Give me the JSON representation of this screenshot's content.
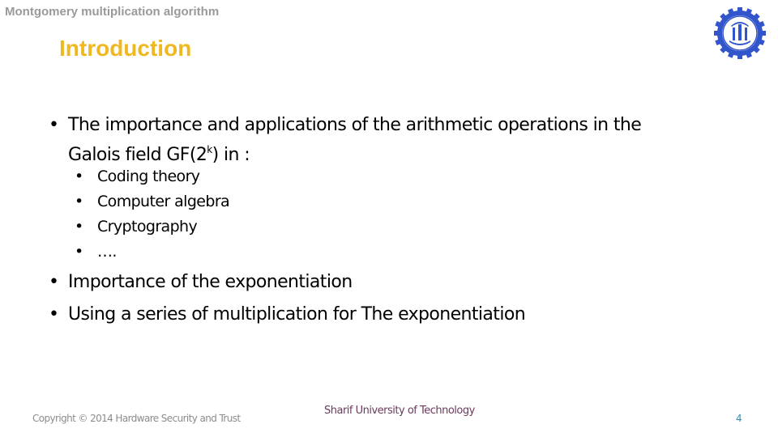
{
  "slide": {
    "deck_title": "Montgomery multiplication algorithm",
    "title": "Introduction",
    "logo": {
      "icon": "sharif-university-logo-icon",
      "color": "#3355cc"
    },
    "bullets": [
      {
        "text_line1": "The importance and applications of the arithmetic operations in the",
        "text_line2_pre": "Galois field GF(2",
        "text_line2_sup": "k",
        "text_line2_post": ") in :",
        "subitems": [
          "Coding theory",
          "Computer algebra",
          "Cryptography",
          "…."
        ]
      },
      {
        "text": "Importance of the exponentiation"
      },
      {
        "text": "Using a series of multiplication for The exponentiation"
      }
    ],
    "bullet_glyph": "•",
    "footer": {
      "copyright": "Copyright © 2014 Hardware Security and Trust",
      "institution": "Sharif University of Technology",
      "page_number": "4"
    },
    "colors": {
      "deck_title": "#9a9a9a",
      "title": "#f0b820",
      "institution": "#6b3a5e",
      "page_number": "#2f8fb8"
    }
  }
}
